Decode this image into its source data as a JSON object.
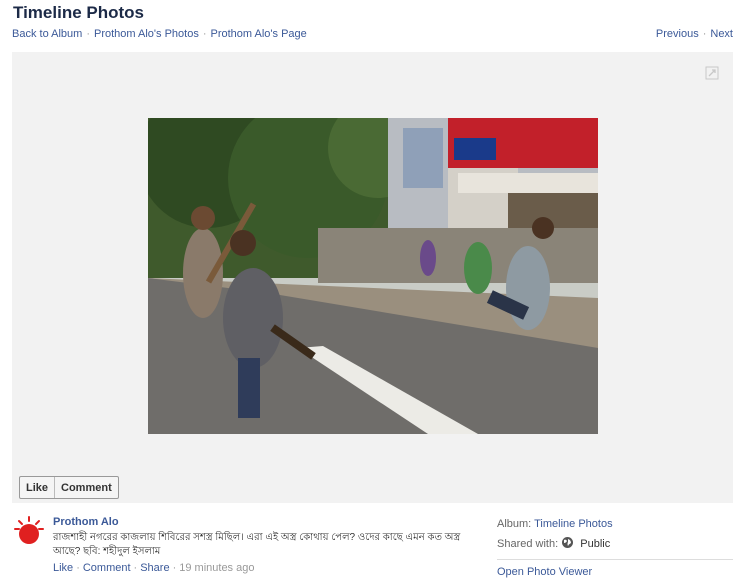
{
  "header": {
    "title": "Timeline Photos"
  },
  "breadcrumbs": [
    {
      "label": "Back to Album"
    },
    {
      "label": "Prothom Alo's Photos"
    },
    {
      "label": "Prothom Alo's Page"
    }
  ],
  "pager": {
    "previous": "Previous",
    "next": "Next"
  },
  "photo_actions": {
    "like": "Like",
    "comment": "Comment"
  },
  "post": {
    "author": "Prothom Alo",
    "caption": "রাজশাহী নগরের কাজলায় শিবিরের সশস্ত্র মিছিল। এরা এই অস্ত্র কোথায় পেল? ওদের কাছে এমন কত অস্ত্র আছে? ছবি: শহীদুল ইসলাম",
    "like": "Like",
    "comment": "Comment",
    "share": "Share",
    "time": "19 minutes ago"
  },
  "sidebar": {
    "album_label": "Album:",
    "album_value": "Timeline Photos",
    "shared_label": "Shared with:",
    "shared_value": "Public",
    "open_viewer": "Open Photo Viewer"
  },
  "icons": {
    "expand": "expand-icon",
    "globe": "globe-icon",
    "avatar": "prothom-alo-logo"
  },
  "colors": {
    "link": "#3b5998",
    "title": "#1c2a47",
    "stage": "#f2f2f2",
    "logo": "#e02020"
  }
}
